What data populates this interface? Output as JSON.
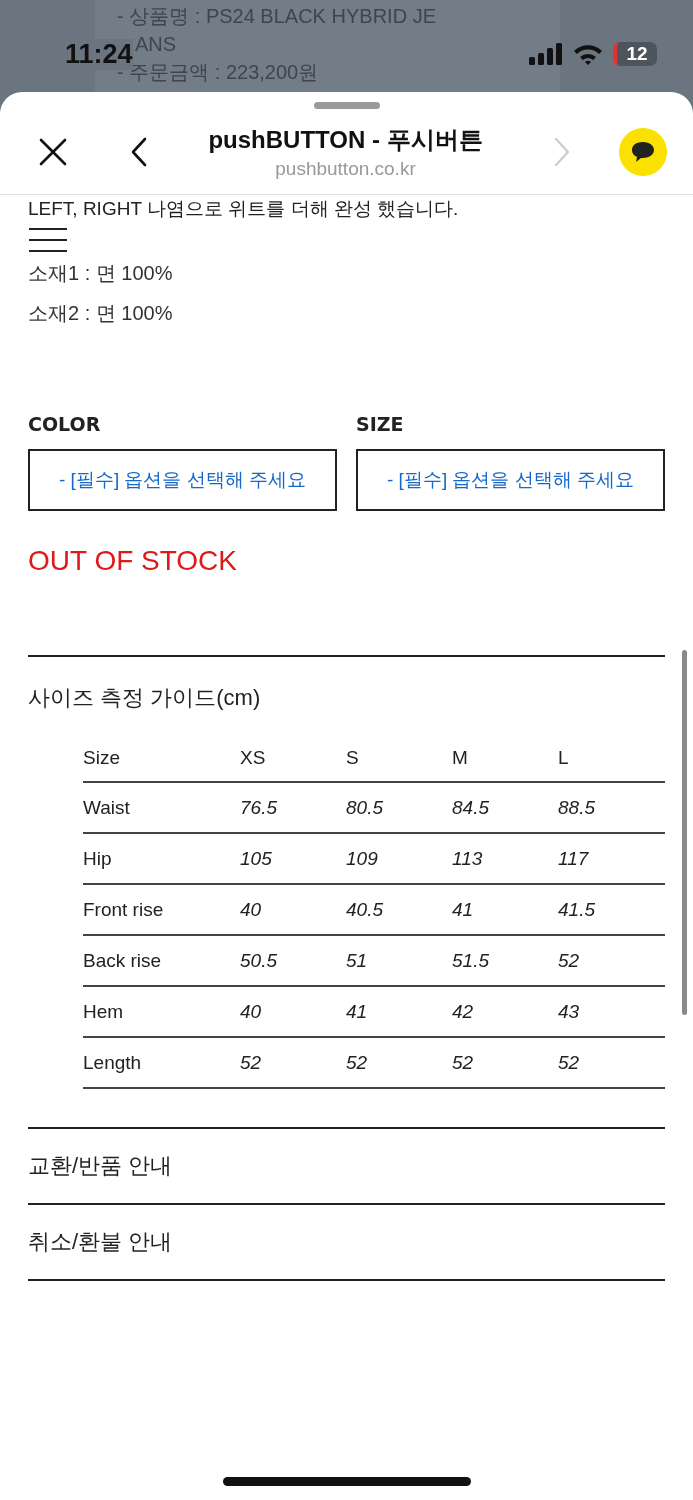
{
  "background_page": {
    "lines": [
      "- 상품명 : PS24 BLACK HYBRID JE",
      "ANS",
      "- 주문금액 : 223,200원"
    ]
  },
  "status_bar": {
    "time": "11:24",
    "battery": "12"
  },
  "browser_header": {
    "title": "pushBUTTON - 푸시버튼",
    "url": "pushbutton.co.kr",
    "back_disabled": false,
    "forward_disabled": true
  },
  "description": {
    "lines": [
      "LEFT, RIGHT 나염으로 위트를 더해 완성 했습니다."
    ],
    "materials": [
      "소재1 : 면 100%",
      "소재2 : 면 100%"
    ]
  },
  "options": [
    {
      "label": "COLOR",
      "placeholder": "- [필수] 옵션을 선택해 주세요"
    },
    {
      "label": "SIZE",
      "placeholder": "- [필수] 옵션을 선택해 주세요"
    }
  ],
  "stock_status": "OUT OF STOCK",
  "size_guide": {
    "title": "사이즈 측정 가이드(cm)",
    "columns": [
      "Size",
      "XS",
      "S",
      "M",
      "L"
    ],
    "rows": [
      [
        "Waist",
        "76.5",
        "80.5",
        "84.5",
        "88.5"
      ],
      [
        "Hip",
        "105",
        "109",
        "113",
        "117"
      ],
      [
        "Front rise",
        "40",
        "40.5",
        "41",
        "41.5"
      ],
      [
        "Back rise",
        "50.5",
        "51",
        "51.5",
        "52"
      ],
      [
        "Hem",
        "40",
        "41",
        "42",
        "43"
      ],
      [
        "Length",
        "52",
        "52",
        "52",
        "52"
      ]
    ]
  },
  "info_sections": [
    "교환/반품 안내",
    "취소/환불 안내"
  ]
}
